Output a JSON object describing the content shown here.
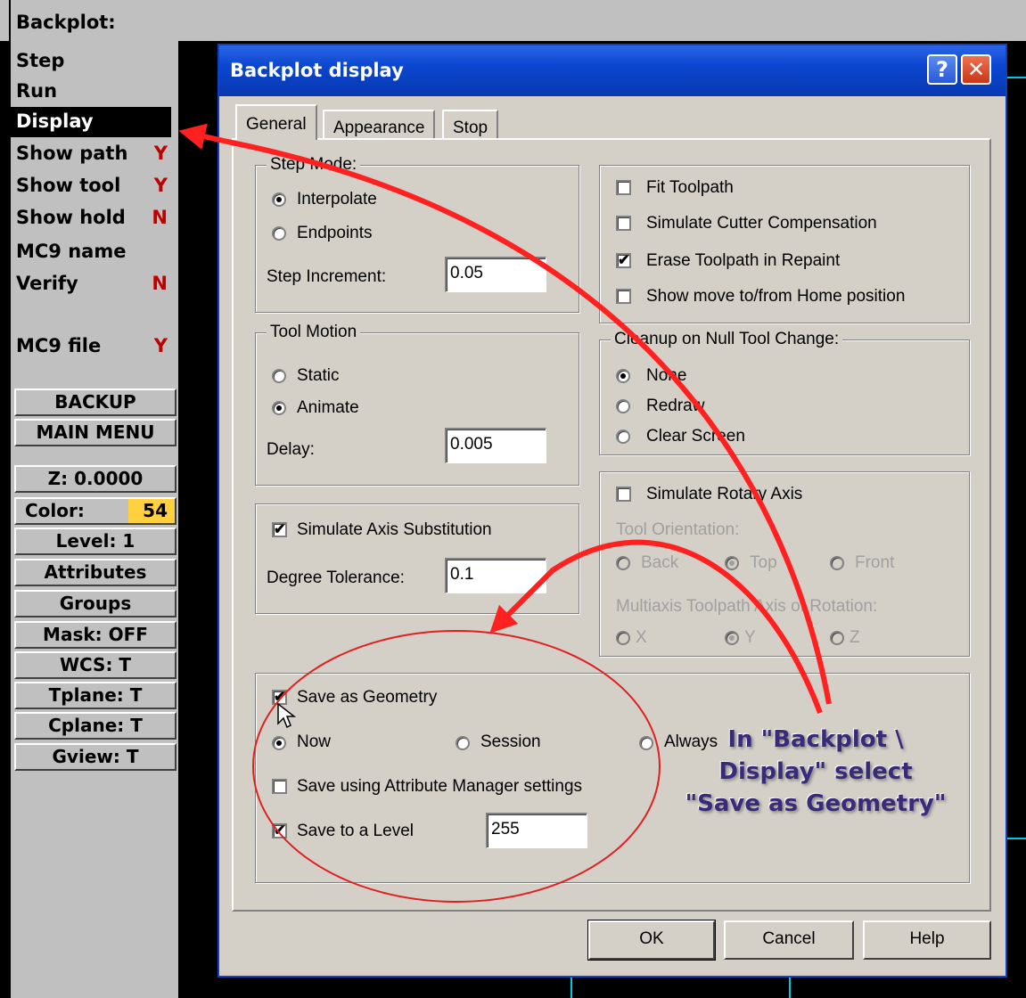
{
  "window": {
    "title": "Backplot:"
  },
  "sidebar": {
    "menu": [
      {
        "label": "Step",
        "value": ""
      },
      {
        "label": "Run",
        "value": ""
      },
      {
        "label": "Display",
        "value": ""
      },
      {
        "label": "Show path",
        "value": "Y"
      },
      {
        "label": "Show tool",
        "value": "Y"
      },
      {
        "label": "Show hold",
        "value": "N"
      },
      {
        "label": "MC9 name",
        "value": ""
      },
      {
        "label": "Verify",
        "value": "N"
      },
      {
        "label": "MC9 file",
        "value": "Y"
      }
    ],
    "backup": "BACKUP",
    "main_menu": "MAIN MENU",
    "z": "Z: 0.0000",
    "color_label": "Color:",
    "color_value": "54",
    "level": "Level: 1",
    "attributes": "Attributes",
    "groups": "Groups",
    "mask": "Mask: OFF",
    "wcs": "WCS: T",
    "tplane": "Tplane: T",
    "cplane": "Cplane: T",
    "gview": "Gview: T"
  },
  "dialog": {
    "title": "Backplot display",
    "help_icon": "?",
    "close_icon": "✕",
    "tabs": [
      "General",
      "Appearance",
      "Stop"
    ],
    "step_mode": {
      "title": "Step Mode:",
      "interpolate": "Interpolate",
      "endpoints": "Endpoints",
      "increment_label": "Step Increment:",
      "increment_value": "0.05"
    },
    "tool_motion": {
      "title": "Tool Motion",
      "static": "Static",
      "animate": "Animate",
      "delay_label": "Delay:",
      "delay_value": "0.005"
    },
    "axis_sub": {
      "label": "Simulate Axis Substitution",
      "tolerance_label": "Degree Tolerance:",
      "tolerance_value": "0.1"
    },
    "options": {
      "fit": "Fit Toolpath",
      "cutter_comp": "Simulate Cutter Compensation",
      "erase": "Erase Toolpath in Repaint",
      "home": "Show move to/from Home position"
    },
    "cleanup": {
      "title": "Cleanup on Null Tool Change:",
      "none": "None",
      "redraw": "Redraw",
      "clear": "Clear Screen"
    },
    "rotary": {
      "label": "Simulate Rotary Axis",
      "orientation_label": "Tool Orientation:",
      "back": "Back",
      "top": "Top",
      "front": "Front",
      "multiaxis_label": "Multiaxis Toolpath Axis of Rotation:",
      "x": "X",
      "y": "Y",
      "z": "Z"
    },
    "save": {
      "geometry": "Save as Geometry",
      "now": "Now",
      "session": "Session",
      "always": "Always",
      "attr_mgr": "Save using Attribute Manager settings",
      "to_level": "Save to a Level",
      "level_value": "255"
    },
    "buttons": {
      "ok": "OK",
      "cancel": "Cancel",
      "help": "Help"
    }
  },
  "annotation": {
    "line1": "In \"Backplot \\",
    "line2": "Display\" select",
    "line3": "\"Save as Geometry\"",
    "color": "#ff2020"
  }
}
